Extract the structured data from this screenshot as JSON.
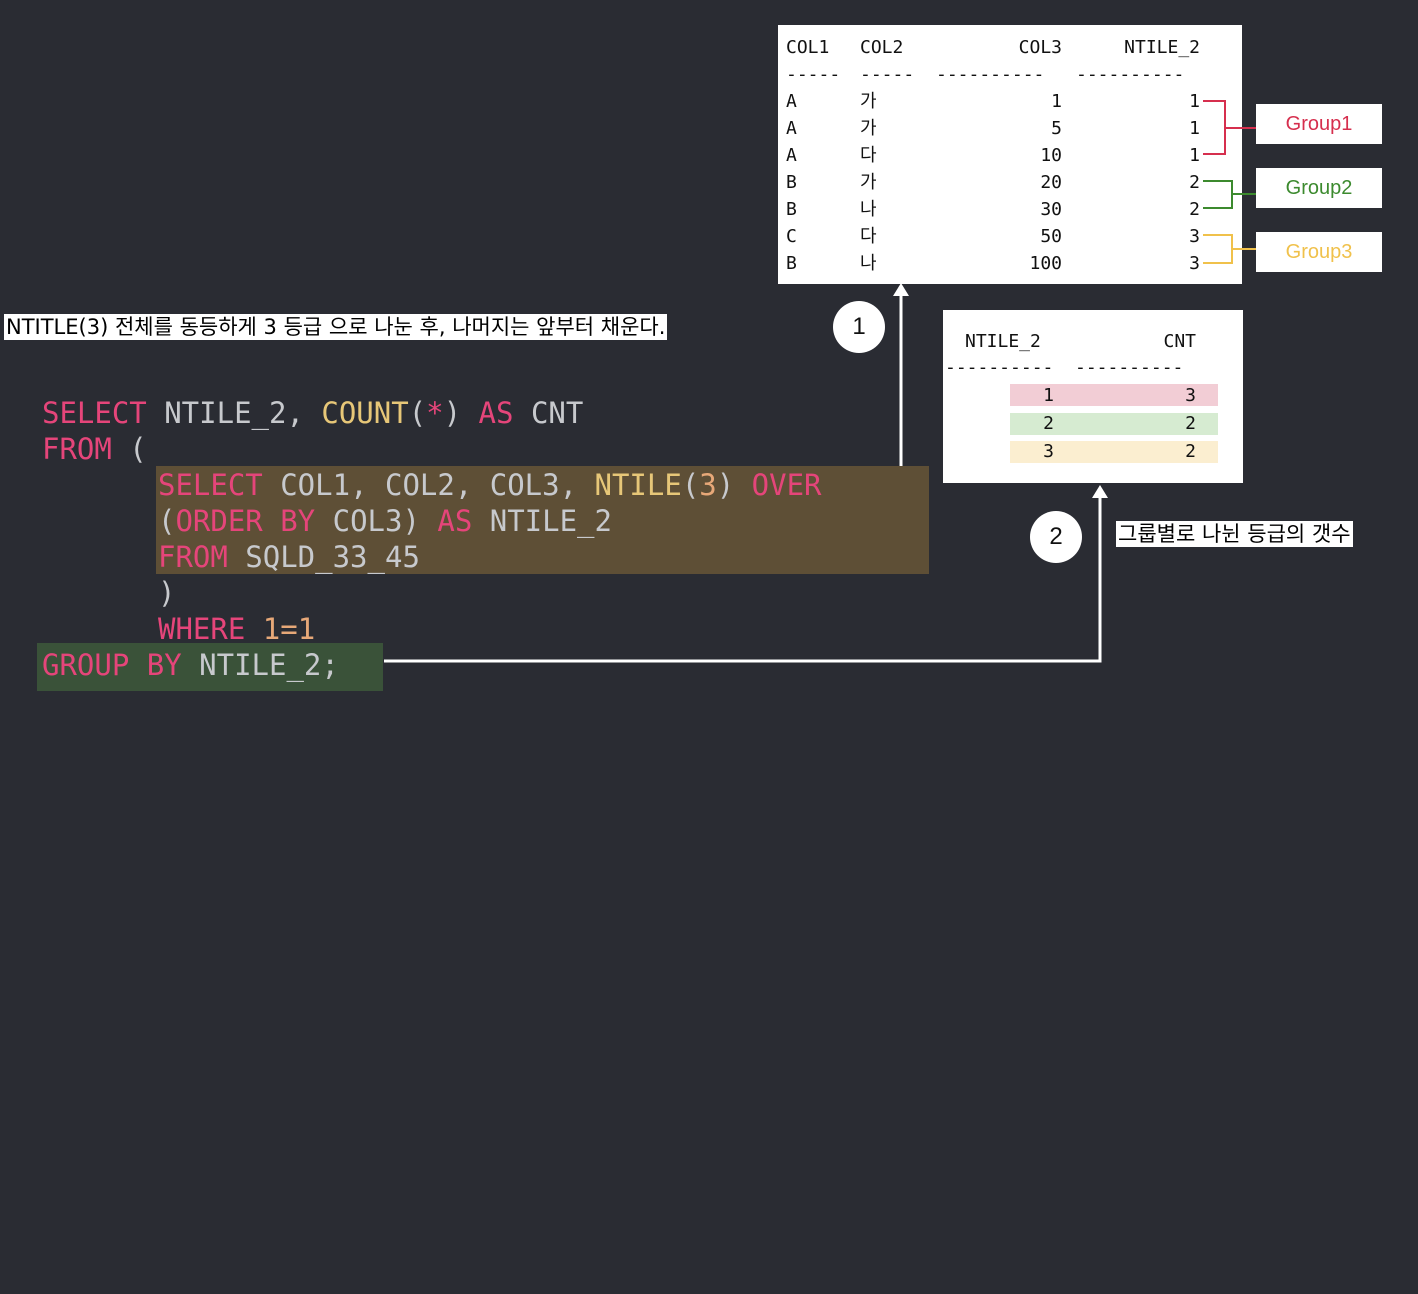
{
  "colors": {
    "background": "#2a2c33",
    "group1": "#d62f4e",
    "group2": "#3c8a2e",
    "group3": "#f0c14b",
    "band1": "#f2cdd5",
    "band2": "#d6ebd1",
    "band3": "#fbeed0",
    "highlight_subquery": "#5e4f36",
    "highlight_groupby": "#3a5239"
  },
  "top_table": {
    "headers": [
      "COL1",
      "COL2",
      "COL3",
      "NTILE_2"
    ],
    "dashes": [
      "-----",
      "-----",
      "----------",
      "----------"
    ],
    "rows": [
      [
        "A",
        "가",
        "1",
        "1"
      ],
      [
        "A",
        "가",
        "5",
        "1"
      ],
      [
        "A",
        "다",
        "10",
        "1"
      ],
      [
        "B",
        "가",
        "20",
        "2"
      ],
      [
        "B",
        "나",
        "30",
        "2"
      ],
      [
        "C",
        "다",
        "50",
        "3"
      ],
      [
        "B",
        "나",
        "100",
        "3"
      ]
    ]
  },
  "groups": [
    {
      "label": "Group1"
    },
    {
      "label": "Group2"
    },
    {
      "label": "Group3"
    }
  ],
  "bottom_table": {
    "headers": [
      "NTILE_2",
      "CNT"
    ],
    "dashes": [
      "----------",
      "----------"
    ],
    "rows": [
      [
        "1",
        "3"
      ],
      [
        "2",
        "2"
      ],
      [
        "3",
        "2"
      ]
    ]
  },
  "callouts": {
    "one": {
      "number": "1",
      "text": "NTITLE(3) 전체를 동등하게 3 등급 으로 나눈 후, 나머지는 앞부터 채운다."
    },
    "two": {
      "number": "2",
      "text": "그룹별로 나뉜 등급의 갯수"
    }
  },
  "code": {
    "l1_select": "SELECT",
    "l1_ntile": " NTILE_2, ",
    "l1_count": "COUNT",
    "l1_open": "(",
    "l1_star": "*",
    "l1_close": ")",
    "l1_as": " AS",
    "l1_cnt": " CNT",
    "l2_from": "FROM",
    "l2_paren": " (",
    "l3_select": "SELECT",
    "l3_cols": " COL1, COL2, COL3, ",
    "l3_ntile": "NTILE",
    "l3_open": "(",
    "l3_three": "3",
    "l3_close": ") ",
    "l3_over": "OVER",
    "l4_open": "(",
    "l4_orderby": "ORDER BY",
    "l4_col3": " COL3) ",
    "l4_as": "AS",
    "l4_alias": " NTILE_2",
    "l5_from": "FROM",
    "l5_table": " SQLD_33_45",
    "l6_paren": ")",
    "l7_where": "WHERE",
    "l7_cond": " 1=1",
    "l8_groupby": "GROUP BY",
    "l8_col": " NTILE_2;"
  }
}
